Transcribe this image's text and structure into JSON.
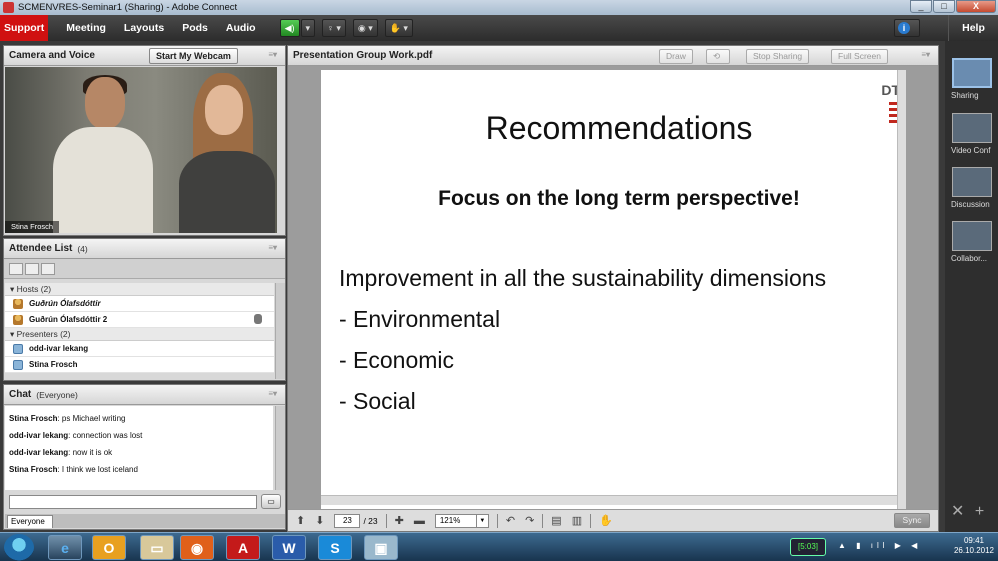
{
  "window": {
    "title": "SCMENVRES-Seminar1 (Sharing) - Adobe Connect",
    "min_label": "_",
    "max_label": "□",
    "close_label": "X"
  },
  "menubar": {
    "support": "Support",
    "items": [
      "Meeting",
      "Layouts",
      "Pods",
      "Audio"
    ],
    "help": "Help"
  },
  "camera_pod": {
    "title": "Camera and Voice",
    "webcam_button": "Start My Webcam",
    "speaker_name": "Stina Frosch"
  },
  "attendee_pod": {
    "title": "Attendee List",
    "count": "(4)",
    "hosts_label": "Hosts (2)",
    "hosts": [
      "Guðrún Ólafsdóttir",
      "Guðrún Ólafsdóttir 2"
    ],
    "presenters_label": "Presenters (2)",
    "presenters": [
      "odd-ivar lekang",
      "Stina Frosch"
    ]
  },
  "chat_pod": {
    "title": "Chat",
    "scope": "(Everyone)",
    "messages": [
      {
        "sender": "Stina Frosch",
        "text": "ps Michael writing"
      },
      {
        "sender": "odd-ivar lekang",
        "text": "connection was lost"
      },
      {
        "sender": "odd-ivar lekang",
        "text": "now it is ok"
      },
      {
        "sender": "Stina Frosch",
        "text": "I think we lost iceland"
      }
    ],
    "tab": "Everyone"
  },
  "share_pod": {
    "title": "Presentation Group Work.pdf",
    "buttons": {
      "draw": "Draw",
      "stop": "Stop Sharing",
      "fullscreen": "Full Screen"
    },
    "slide": {
      "title": "Recommendations",
      "subtitle": "Focus on the long term perspective!",
      "intro": "Improvement in all the sustainability dimensions",
      "bullets": [
        "-  Environmental",
        "-  Economic",
        "-  Social"
      ],
      "logo": "DT"
    },
    "toolbar": {
      "page": "23",
      "total": "/ 23",
      "zoom": "121%",
      "sync": "Sync"
    }
  },
  "layouts": [
    {
      "label": "Sharing",
      "active": true
    },
    {
      "label": "Video Conf",
      "active": false
    },
    {
      "label": "Discussion",
      "active": false
    },
    {
      "label": "Collabor...",
      "active": false
    }
  ],
  "taskbar": {
    "timer": "[5:03]",
    "time": "09:41",
    "date": "26.10.2012"
  }
}
